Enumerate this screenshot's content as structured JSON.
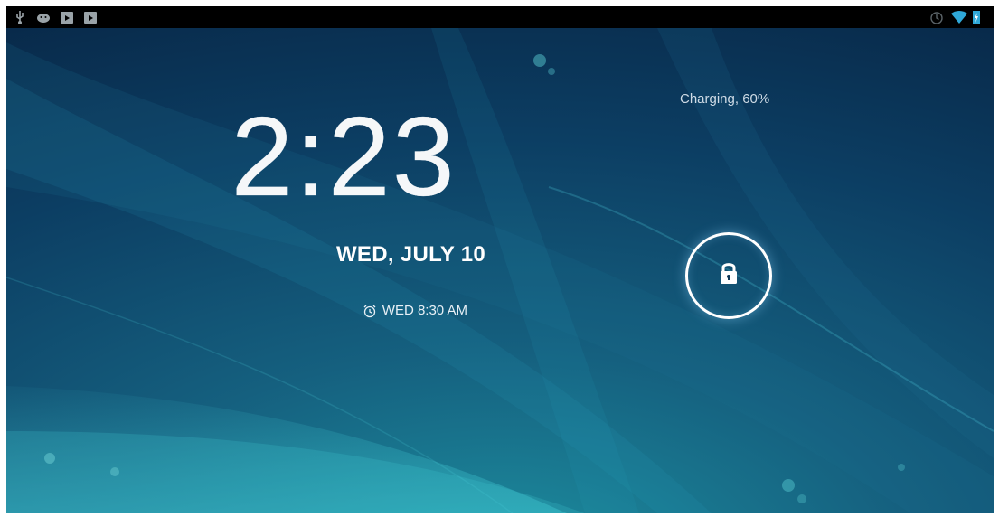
{
  "status_bar": {
    "left_icons": [
      "usb-icon",
      "android-debug-icon",
      "media-icon",
      "media-icon"
    ],
    "right_icons": [
      "alarm-icon",
      "wifi-icon",
      "battery-charging-icon"
    ]
  },
  "lockscreen": {
    "time": "2:23",
    "date": "WED, JULY 10",
    "alarm": "WED 8:30 AM",
    "charging_status": "Charging, 60%",
    "lock_icon": "lock-icon"
  },
  "colors": {
    "background": "#0b3556",
    "accent": "#2aa7c9",
    "text": "#ffffff"
  }
}
